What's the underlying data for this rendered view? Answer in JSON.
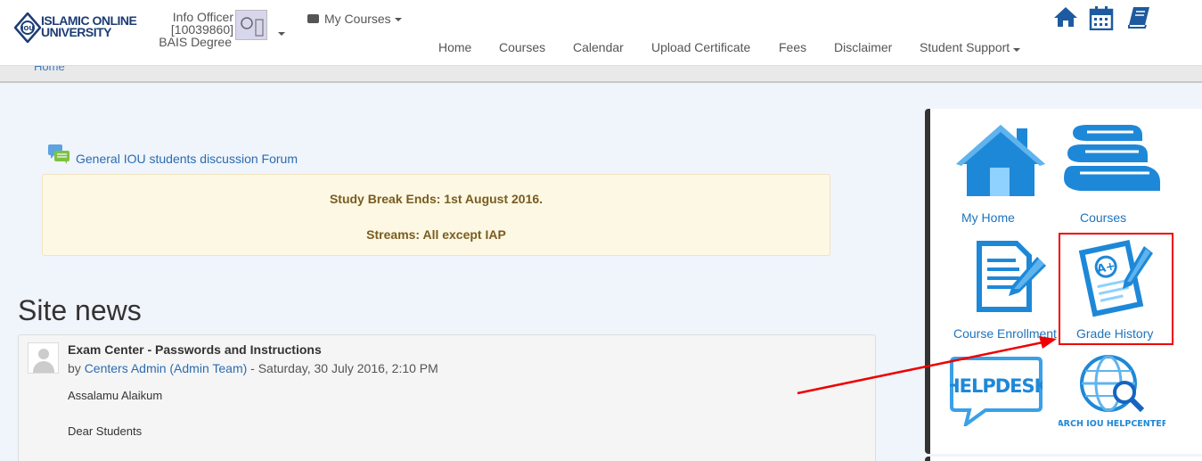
{
  "header": {
    "logo_text_line1": "ISLAMIC ONLINE",
    "logo_text_line2": "UNIVERSITY",
    "user": {
      "name": "Info Officer",
      "id": "[10039860]",
      "program": "BAIS Degree"
    },
    "my_courses_label": "My Courses",
    "nav": [
      "Home",
      "Courses",
      "Calendar",
      "Upload Certificate",
      "Fees",
      "Disclaimer",
      "Student Support"
    ],
    "icons": [
      "home-icon",
      "calendar-icon",
      "book-icon"
    ],
    "accent_color": "#1e5aa0"
  },
  "breadcrumb": {
    "home": "Home"
  },
  "forum": {
    "link": "General IOU students discussion Forum"
  },
  "notice": {
    "line1": "Study Break Ends: 1st August 2016.",
    "line2": "Streams: All except IAP"
  },
  "site_news": {
    "title": "Site news",
    "post": {
      "title": "Exam Center - Passwords and Instructions",
      "by": "by ",
      "author": "Centers Admin (Admin Team)",
      "date": " - Saturday, 30 July 2016, 2:10 PM",
      "p1": "Assalamu Alaikum",
      "p2": "Dear Students"
    }
  },
  "quick_links": {
    "my_home": "My  Home",
    "courses": "Courses",
    "course_enrollment": "Course Enrollment",
    "grade_history": "Grade History",
    "helpdesk": "HELPDESK",
    "search_helpcenter": "SEARCH IOU HELPCENTER",
    "tile_color": "#1e88d8"
  }
}
